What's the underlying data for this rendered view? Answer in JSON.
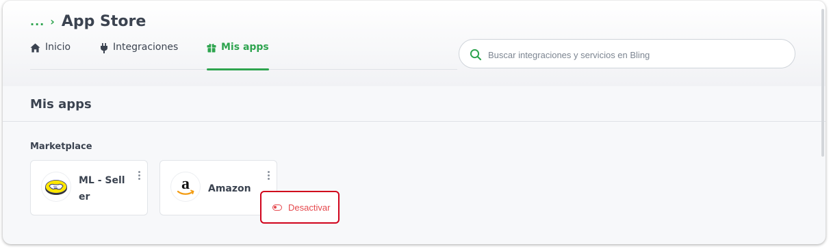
{
  "breadcrumb": {
    "ellipsis": "...",
    "separator": "›",
    "title": "App Store"
  },
  "tabs": [
    {
      "label": "Inicio",
      "icon": "home-icon"
    },
    {
      "label": "Integraciones",
      "icon": "plug-icon"
    },
    {
      "label": "Mis apps",
      "icon": "gift-icon",
      "active": true
    }
  ],
  "search": {
    "placeholder": "Buscar integraciones y servicios en Bling",
    "value": ""
  },
  "section": {
    "title": "Mis apps"
  },
  "group": {
    "label": "Marketplace"
  },
  "cards": [
    {
      "name_line1": "ML - Sell",
      "name_line2": "er",
      "logo": "mercadolibre-logo"
    },
    {
      "name": "Amazon",
      "logo": "amazon-logo"
    }
  ],
  "popup": {
    "label": "Desactivar",
    "icon": "toggle-off-icon"
  },
  "colors": {
    "accent": "#2ea44f",
    "danger": "#e5484d",
    "highlight": "#d0021b",
    "text": "#3b4350"
  }
}
